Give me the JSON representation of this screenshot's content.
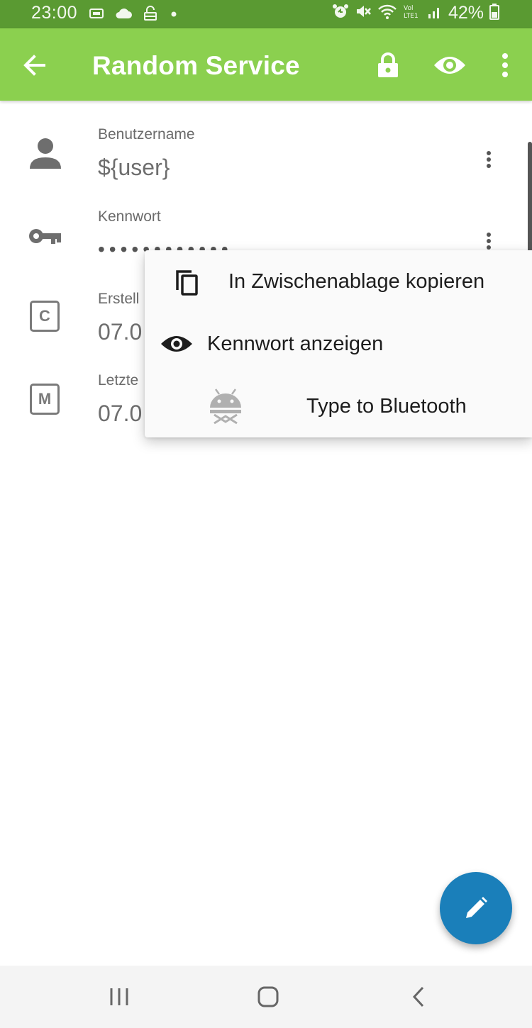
{
  "status_bar": {
    "time": "23:00",
    "battery_percent": "42%",
    "left_icons": [
      "usb-icon",
      "cloud-icon",
      "lock-open-icon",
      "dot-icon"
    ],
    "right_icons": [
      "alarm-icon",
      "mute-icon",
      "wifi-icon",
      "volte-icon",
      "signal-icon",
      "battery-icon"
    ]
  },
  "app_bar": {
    "title": "Random Service",
    "background": "#8bd04f",
    "status_background": "#5a9a32"
  },
  "fields": {
    "username": {
      "label": "Benutzername",
      "value": "${user}"
    },
    "password": {
      "label": "Kennwort",
      "value": "••••••••••••"
    },
    "created": {
      "label": "Erstell",
      "value": "07.0",
      "badge": "C"
    },
    "modified": {
      "label": "Letzte",
      "value": "07.0",
      "badge": "M"
    }
  },
  "popup_menu": {
    "items": [
      {
        "label": "In Zwischenablage kopieren",
        "icon": "copy-icon"
      },
      {
        "label": "Kennwort anzeigen",
        "icon": "eye-icon"
      },
      {
        "label": "Type to Bluetooth",
        "icon": "android-icon"
      }
    ]
  },
  "fab": {
    "icon": "edit-icon",
    "color": "#1a7fba"
  },
  "nav_bar": {
    "icons": [
      "recents-icon",
      "home-icon",
      "back-icon"
    ]
  }
}
